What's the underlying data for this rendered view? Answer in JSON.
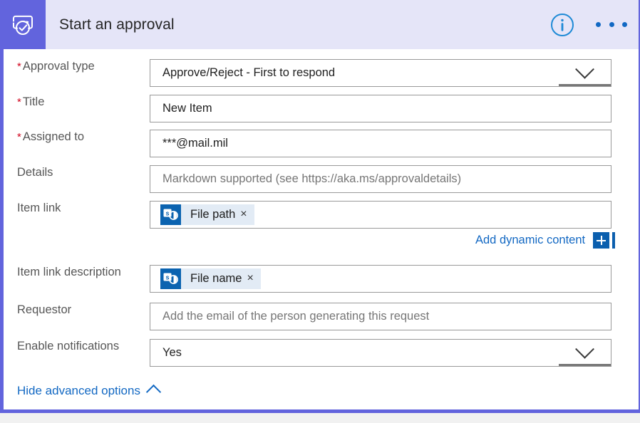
{
  "header": {
    "icon": "approval-icon",
    "title": "Start an approval",
    "info_icon": "info-icon",
    "more_icon": "ellipsis-icon"
  },
  "form": {
    "fields": [
      {
        "label": "Approval type",
        "required": true,
        "type": "dropdown",
        "value": "Approve/Reject - First to respond"
      },
      {
        "label": "Title",
        "required": true,
        "type": "text",
        "value": "New Item"
      },
      {
        "label": "Assigned to",
        "required": true,
        "type": "text",
        "value": "***@mail.mil"
      },
      {
        "label": "Details",
        "required": false,
        "type": "text",
        "placeholder": "Markdown supported (see https://aka.ms/approvaldetails)"
      },
      {
        "label": "Item link",
        "required": false,
        "type": "token",
        "token": {
          "icon": "sharepoint-icon",
          "text": "File path",
          "remove": "×"
        }
      },
      {
        "label": "Item link description",
        "required": false,
        "type": "token",
        "token": {
          "icon": "sharepoint-icon",
          "text": "File name",
          "remove": "×"
        }
      },
      {
        "label": "Requestor",
        "required": false,
        "type": "text",
        "placeholder": "Add the email of the person generating this request"
      },
      {
        "label": "Enable notifications",
        "required": false,
        "type": "dropdown",
        "value": "Yes"
      }
    ]
  },
  "dynamic_content": {
    "label": "Add dynamic content",
    "plus_icon": "plus-icon"
  },
  "advanced": {
    "label": "Hide advanced options",
    "chevron": "chevron-up-icon"
  },
  "colors": {
    "accent_purple": "#6264dd",
    "header_bg": "#e5e5f8",
    "link_blue": "#1268c3",
    "required_red": "#d0021b",
    "chip_bg": "#e2ebf5",
    "sharepoint_blue": "#0b63b0"
  }
}
